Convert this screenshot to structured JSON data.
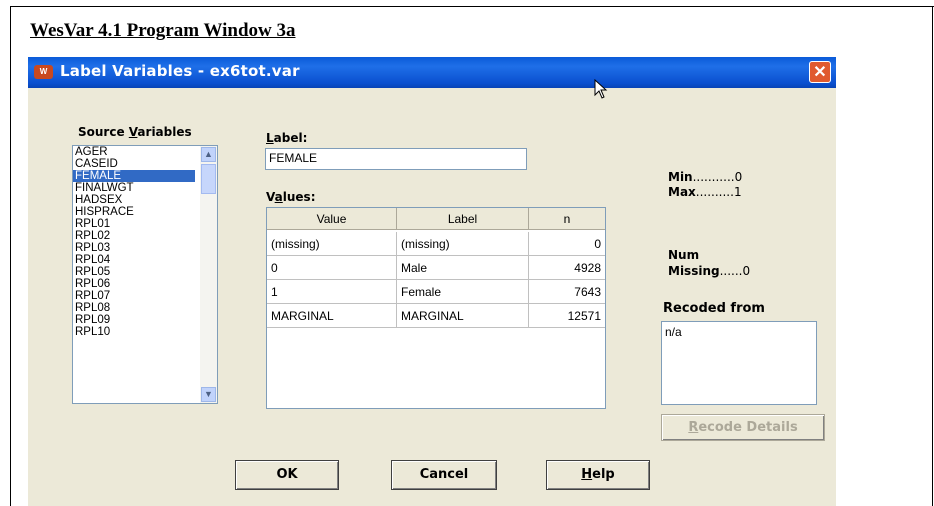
{
  "document": {
    "heading": "WesVar 4.1 Program Window 3a"
  },
  "window": {
    "title": "Label Variables - ex6tot.var",
    "app_icon": "wesvar-app-icon",
    "close_label": "✕"
  },
  "source_variables": {
    "label_pre": "Source ",
    "label_ul": "V",
    "label_post": "ariables",
    "items": [
      "AGER",
      "CASEID",
      "FEMALE",
      "FINALWGT",
      "HADSEX",
      "HISPRACE",
      "RPL01",
      "RPL02",
      "RPL03",
      "RPL04",
      "RPL05",
      "RPL06",
      "RPL07",
      "RPL08",
      "RPL09",
      "RPL10"
    ],
    "selected": "FEMALE"
  },
  "label_field": {
    "label_ul": "L",
    "label_post": "abel:",
    "value": "FEMALE"
  },
  "values": {
    "label_pre": "V",
    "label_ul": "a",
    "label_post": "lues:",
    "columns": [
      "Value",
      "Label",
      "n"
    ],
    "rows": [
      [
        "(missing)",
        "(missing)",
        "0"
      ],
      [
        "0",
        "Male",
        "4928"
      ],
      [
        "1",
        "Female",
        "7643"
      ],
      [
        "MARGINAL",
        "MARGINAL",
        "12571"
      ]
    ]
  },
  "stats": {
    "min_label": "Min",
    "min_dots": "...........",
    "min_value": "0",
    "max_label": "Max",
    "max_dots": "..........",
    "max_value": "1",
    "num_label": "Num",
    "missing_label": "Missing",
    "missing_dots": "......",
    "missing_value": "0"
  },
  "recoded_from": {
    "label": "Recoded from",
    "value": "n/a"
  },
  "buttons": {
    "recode_ul": "R",
    "recode_post": "ecode Details",
    "ok": "OK",
    "cancel": "Cancel",
    "help_ul": "H",
    "help_post": "elp"
  },
  "colors": {
    "titlebar": "#0a5bd8",
    "selection": "#316ac5",
    "dialog_bg": "#ece9d8",
    "close": "#e05a2f"
  }
}
